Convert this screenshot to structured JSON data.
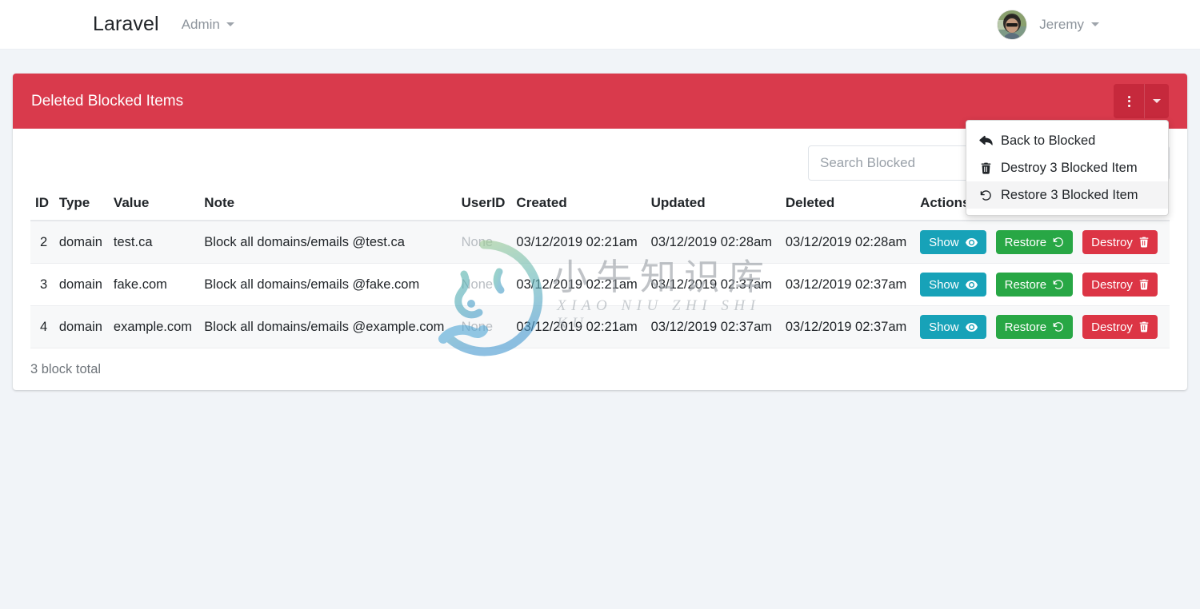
{
  "navbar": {
    "brand": "Laravel",
    "admin_label": "Admin",
    "admin_caret_icon": "caret-down-icon",
    "user_name": "Jeremy",
    "user_caret_icon": "caret-down-icon",
    "avatar_icon": "user-avatar-photo"
  },
  "card": {
    "title": "Deleted Blocked Items",
    "header_color": "#d93a4c",
    "menu_button_icon": "vertical-dots-icon",
    "menu_toggle_icon": "caret-down-icon"
  },
  "dropdown": {
    "items": [
      {
        "label": "Back to Blocked",
        "icon": "reply-arrow-icon",
        "hover": false
      },
      {
        "label": "Destroy 3 Blocked Item",
        "icon": "trash-icon",
        "hover": false
      },
      {
        "label": "Restore 3 Blocked Item",
        "icon": "history-undo-icon",
        "hover": true
      }
    ]
  },
  "search": {
    "placeholder": "Search Blocked",
    "value": ""
  },
  "table": {
    "columns": [
      "ID",
      "Type",
      "Value",
      "Note",
      "UserID",
      "Created",
      "Updated",
      "Deleted",
      "Actions"
    ],
    "rows": [
      {
        "id": "2",
        "type": "domain",
        "value": "test.ca",
        "note": "Block all domains/emails @test.ca",
        "userid": "None",
        "created": "03/12/2019 02:21am",
        "updated": "03/12/2019 02:28am",
        "deleted": "03/12/2019 02:28am"
      },
      {
        "id": "3",
        "type": "domain",
        "value": "fake.com",
        "note": "Block all domains/emails @fake.com",
        "userid": "None",
        "created": "03/12/2019 02:21am",
        "updated": "03/12/2019 02:37am",
        "deleted": "03/12/2019 02:37am"
      },
      {
        "id": "4",
        "type": "domain",
        "value": "example.com",
        "note": "Block all domains/emails @example.com",
        "userid": "None",
        "created": "03/12/2019 02:21am",
        "updated": "03/12/2019 02:37am",
        "deleted": "03/12/2019 02:37am"
      }
    ],
    "action_buttons": {
      "show_label": "Show",
      "show_icon": "eye-icon",
      "show_color": "#17a2b8",
      "restore_label": "Restore",
      "restore_icon": "history-undo-icon",
      "restore_color": "#28a745",
      "destroy_label": "Destroy",
      "destroy_icon": "trash-icon",
      "destroy_color": "#dc3545"
    }
  },
  "footer": {
    "total_text": "3 block total"
  },
  "watermark": {
    "chinese": "小牛知识库",
    "pinyin": "XIAO NIU ZHI SHI KU",
    "logo_icon": "bull-circle-logo"
  }
}
